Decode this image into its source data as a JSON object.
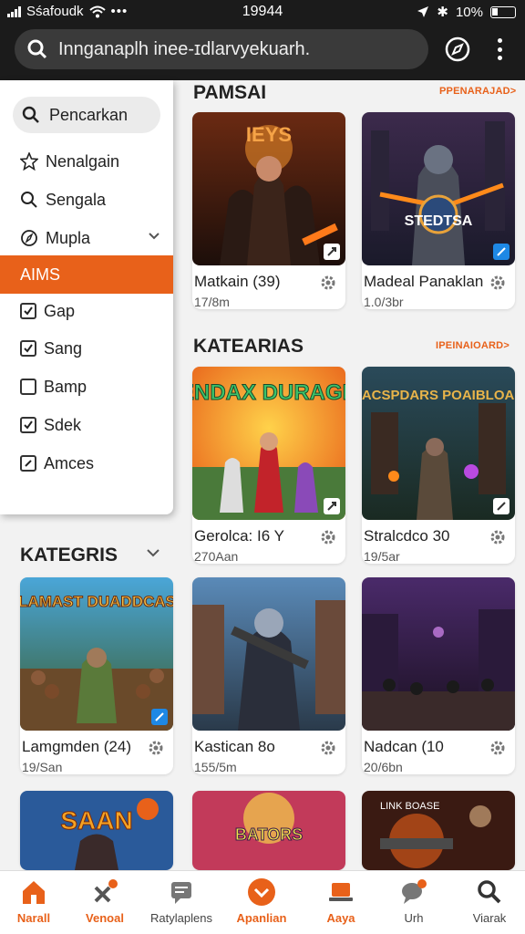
{
  "status": {
    "carrier": "Sśafoudk",
    "time": "19944",
    "battery": "10%"
  },
  "search": {
    "placeholder": "Inngаnaplh inee-ɪdlarvyekuarh."
  },
  "drawer": {
    "search_label": "Pencarkan",
    "items": [
      {
        "label": "Nenalgain",
        "icon": "star-icon"
      },
      {
        "label": "Sengala",
        "icon": "search-icon"
      },
      {
        "label": "Mupla",
        "icon": "compass-icon"
      },
      {
        "label": "AIMS",
        "icon": ""
      },
      {
        "label": "Gap",
        "icon": "checkbox-checked"
      },
      {
        "label": "Sang",
        "icon": "checkbox-checked"
      },
      {
        "label": "Bamp",
        "icon": "checkbox-empty"
      },
      {
        "label": "Sdek",
        "icon": "checkbox-checked"
      },
      {
        "label": "Amces",
        "icon": "checkbox-checked"
      }
    ]
  },
  "sections": {
    "s1_title": "PAMSAI",
    "s1_link": "PPENARAJAD>",
    "s2_title": "KATEARIAS",
    "s2_link": "IPEINAIOARD>",
    "s3_title": "KATEGRIS"
  },
  "cards": [
    {
      "name": "Matkain (39)",
      "sub": "17/8m",
      "art": "IEYS"
    },
    {
      "name": "Madeal Panaklan",
      "sub": "1.0/3br",
      "art": "STEDTSA"
    },
    {
      "name": "Gerolca: I6 Y",
      "sub": "270Aan",
      "art": "ENDAX DURAGH"
    },
    {
      "name": "Stralcdco 30",
      "sub": "19/5ar",
      "art": "SACSPDARS POAIBLOAR"
    },
    {
      "name": "Lamgmden (24)",
      "sub": "19/San",
      "art": "HLAMAST DUADDCASS"
    },
    {
      "name": "Kastican 8o",
      "sub": "155/5m",
      "art": ""
    },
    {
      "name": "Nadcan (10",
      "sub": "20/6bn",
      "art": ""
    },
    {
      "name": "",
      "sub": "",
      "art": "SAAN"
    },
    {
      "name": "",
      "sub": "",
      "art": "BATORS"
    },
    {
      "name": "",
      "sub": "",
      "art": "LINK BOASE"
    }
  ],
  "tabs": [
    {
      "label": "Narall",
      "icon": "home-icon"
    },
    {
      "label": "Venoal",
      "icon": "tools-icon"
    },
    {
      "label": "Ratylaplens",
      "icon": "message-icon"
    },
    {
      "label": "Apanlian",
      "icon": "download-icon"
    },
    {
      "label": "Aaya",
      "icon": "laptop-icon"
    },
    {
      "label": "Urh",
      "icon": "chat-icon"
    },
    {
      "label": "Viarak",
      "icon": "search-icon"
    }
  ],
  "colors": {
    "accent": "#e8611a",
    "appbar": "#1b1b1b"
  }
}
